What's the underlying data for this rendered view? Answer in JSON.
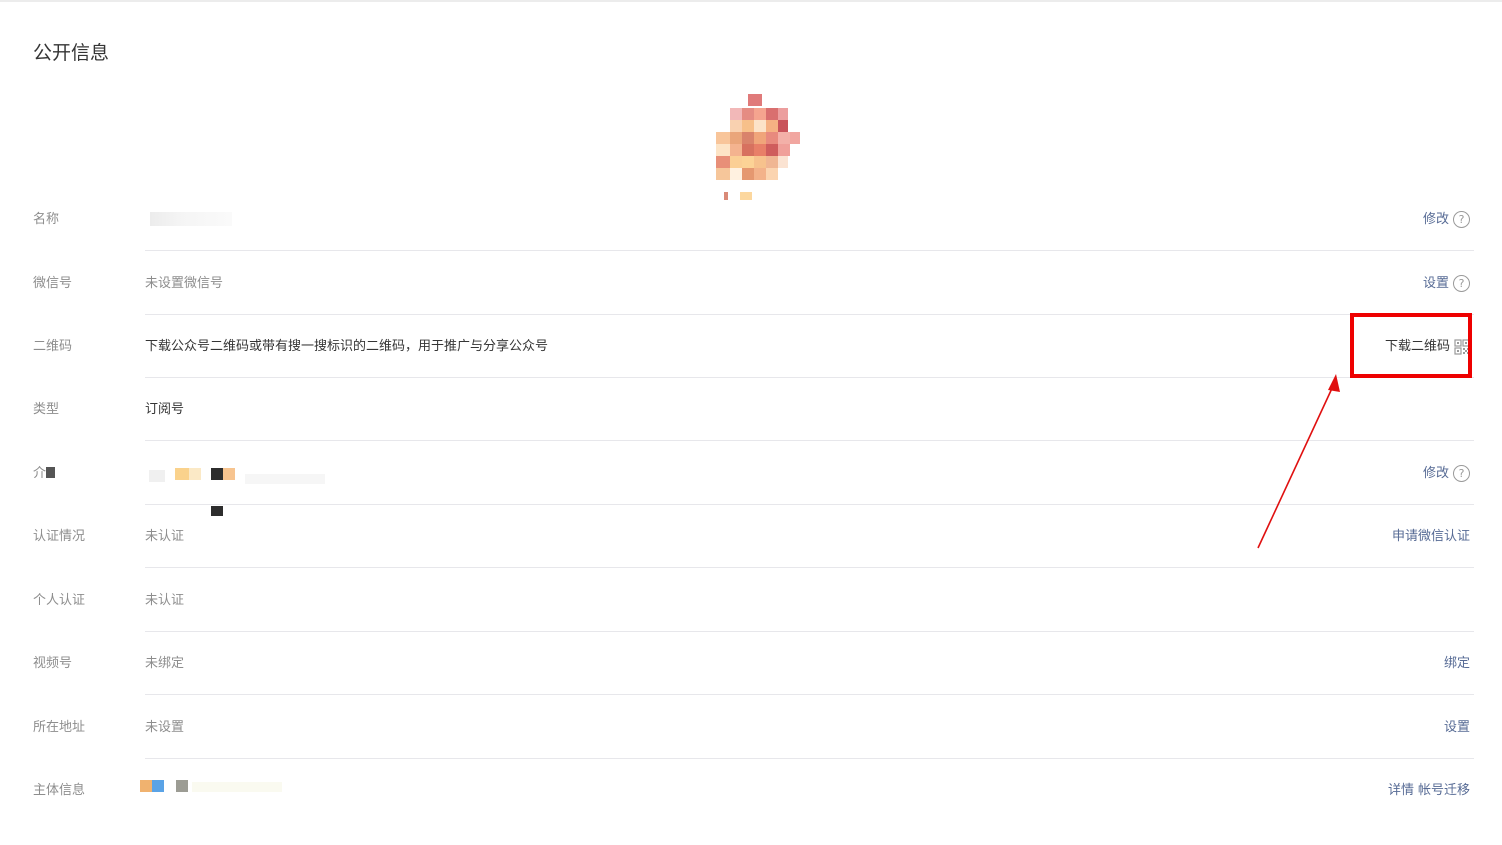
{
  "section": {
    "title": "公开信息"
  },
  "rows": {
    "name": {
      "label": "名称",
      "action": "修改"
    },
    "wechat_id": {
      "label": "微信号",
      "value": "未设置微信号",
      "action": "设置"
    },
    "qrcode": {
      "label": "二维码",
      "value": "下载公众号二维码或带有搜一搜标识的二维码，用于推广与分享公众号",
      "action": "下载二维码"
    },
    "type": {
      "label": "类型",
      "value": "订阅号"
    },
    "intro": {
      "label": "介",
      "action": "修改"
    },
    "verification": {
      "label": "认证情况",
      "value": "未认证",
      "action": "申请微信认证"
    },
    "personal_verification": {
      "label": "个人认证",
      "value": "未认证"
    },
    "video": {
      "label": "视频号",
      "value": "未绑定",
      "action": "绑定"
    },
    "address": {
      "label": "所在地址",
      "value": "未设置",
      "action": "设置"
    },
    "entity": {
      "label": "主体信息",
      "action_details": "详情",
      "action_migrate": "帐号迁移"
    }
  },
  "colors": {
    "link": "#576b95",
    "highlight": "#ee0000",
    "label": "#8d8d8d"
  },
  "icons": {
    "help": "question-circle-icon",
    "qr": "qr-code-icon"
  }
}
